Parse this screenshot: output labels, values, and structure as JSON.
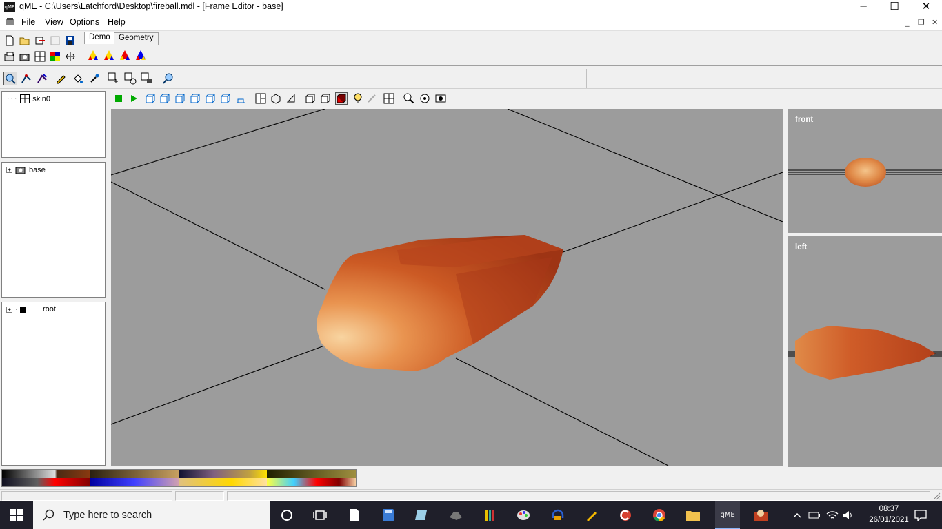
{
  "window": {
    "app_icon_text": "qME",
    "title": "qME - C:\\Users\\Latchford\\Desktop\\fireball.mdl - [Frame Editor - base]",
    "minimize": "─",
    "maximize": "☐",
    "close": "✕"
  },
  "menu": {
    "items": [
      "File",
      "View",
      "Options",
      "Help"
    ],
    "mdi_min": "_",
    "mdi_restore": "❐",
    "mdi_close": "✕"
  },
  "tabs": [
    "Demo",
    "Geometry"
  ],
  "tree": {
    "skins": {
      "label": "skin0"
    },
    "frames": {
      "label": "base",
      "expander": "+"
    },
    "bones": {
      "label": "root",
      "expander": "+"
    }
  },
  "viewports": {
    "front": "front",
    "left": "left"
  },
  "colors": {
    "viewport_bg": "#9c9c9c",
    "model_light": "#f5c08a",
    "model_mid": "#d4622c",
    "model_dark": "#a8391a"
  },
  "taskbar": {
    "search_placeholder": "Type here to search",
    "active_app": "qME",
    "time": "08:37",
    "date": "26/01/2021"
  }
}
